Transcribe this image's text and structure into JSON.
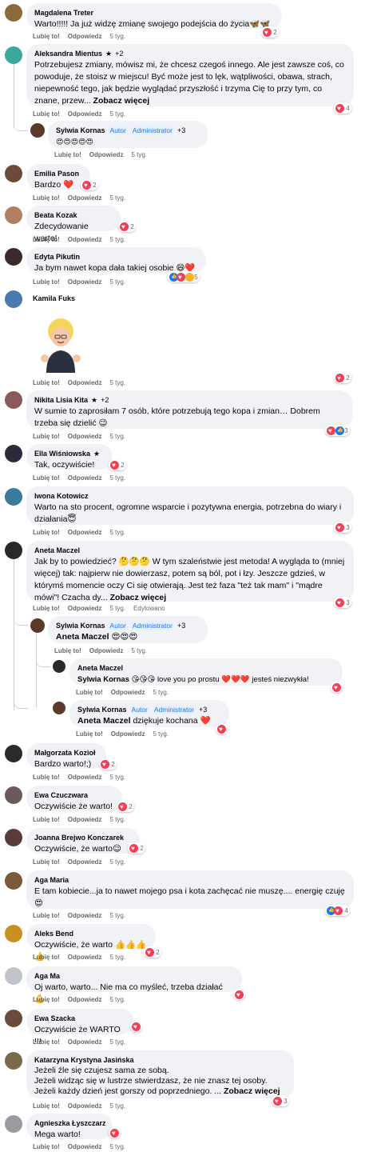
{
  "labels": {
    "like": "Lubię to!",
    "reply": "Odpowiedz",
    "edited": "Edytowano",
    "see_more": "Zobacz więcej",
    "author": "Autor",
    "admin": "Administrator"
  },
  "comments": [
    {
      "name": "Magdalena Treter",
      "text": "Warto!!!!! Ja już widzę zmianę swojego podejścia do życia🦋🦋",
      "time": "5 tyg.",
      "count": "2",
      "avatar": "#8a6a3a"
    },
    {
      "name": "Aleksandra Mientus",
      "badge": "+2",
      "text": "Potrzebujesz zmiany, mówisz mi, że chcesz czegoś innego. Ale jest zawsze coś, co powoduje, że stoisz w miejscu! Być może jest to lęk, wątpliwości, obawa, strach, niepewność tego, jak będzie wyglądać przyszłość i trzyma Cię to przy tym, co znane, przew...",
      "time": "5 tyg.",
      "count": "4",
      "avatar": "#3aa89a"
    },
    {
      "name": "Sylwia Kornas",
      "badge": "+3",
      "text": "😍😍😍😍😍",
      "time": "5 tyg.",
      "avatar": "#5b3a2a"
    },
    {
      "name": "Emilia Pason",
      "text": "Bardzo ❤️",
      "time": "5 tyg.",
      "count": "2",
      "avatar": "#6b4a3a"
    },
    {
      "name": "Beata Kozak",
      "text": "Zdecydowanie warto!",
      "time": "5 tyg.",
      "count": "2",
      "avatar": "#b08060"
    },
    {
      "name": "Edyta Pikutin",
      "text": "Ja bym nawet kopa dała takiej osobie 😄❤️",
      "time": "5 tyg.",
      "count": "5",
      "avatar": "#3a2a2a"
    },
    {
      "name": "Kamila Fuks",
      "time": "5 tyg.",
      "count": "2",
      "avatar": "#4a7ab0"
    },
    {
      "name": "Nikita Lisia Kita",
      "badge": "+2",
      "text": "W sumie to zaprosiłam 7 osób, które potrzebują tego kopa i zmian… Dobrem trzeba się dzielić 😉",
      "time": "5 tyg.",
      "count": "3",
      "avatar": "#8a5a5a"
    },
    {
      "name": "Ella Wiśniowska",
      "text": "Tak, oczywiście!",
      "time": "5 tyg.",
      "count": "2",
      "avatar": "#2a2a3a"
    },
    {
      "name": "Iwona Kotowicz",
      "text": "Warto na sto procent, ogromne wsparcie i pozytywna energia, potrzebna do wiary i działania😇",
      "time": "5 tyg.",
      "count": "3",
      "avatar": "#3a7a9a"
    },
    {
      "name": "Aneta Maczel",
      "text": "Jak by to powiedzieć? 🤔🤔🤔 W tym szaleństwie jest metoda! A wygląda to (mniej więcej) tak: najpierw nie dowierzasz, potem są ból, pot i łzy. Jeszcze gdzieś, w którymś momencie oczy Ci się otwierają. Jest też faza \"też tak mam\" i \"mądre mówi\"! Czacha dy...",
      "time": "5 tyg.",
      "count": "3",
      "avatar": "#2a2a2a"
    },
    {
      "name": "Sylwia Kornas",
      "badge": "+3",
      "mention": "Aneta Maczel",
      "text": "😍😍😍",
      "time": "5 tyg.",
      "avatar": "#5b3a2a"
    },
    {
      "name": "Aneta Maczel",
      "mention": "Sylwia Kornas",
      "text": "😘😘😘 love you po prostu ❤️❤️❤️ jesteś niezwykła!",
      "time": "5 tyg.",
      "avatar": "#2a2a2a"
    },
    {
      "name": "Sylwia Kornas",
      "badge": "+3",
      "mention": "Aneta Maczel",
      "text": "dziękuje kochana ❤️",
      "time": "5 tyg.",
      "avatar": "#5b3a2a"
    },
    {
      "name": "Małgorzata Kozioł",
      "text": "Bardzo warto!;)",
      "time": "5 tyg.",
      "count": "2",
      "avatar": "#2a2a2a"
    },
    {
      "name": "Ewa Czuczwara",
      "text": "Oczywiście że warto!",
      "time": "5 tyg.",
      "count": "2",
      "avatar": "#6a5a5a"
    },
    {
      "name": "Joanna Brejwo Konczarek",
      "text": "Oczywiście, że warto😉",
      "time": "5 tyg.",
      "count": "2",
      "avatar": "#5a3a3a"
    },
    {
      "name": "Aga Maria",
      "text": "E tam kobiecie...ja to nawet mojego psa i kota zachęcać nie muszę.... energię czuję 😍",
      "time": "5 tyg.",
      "count": "4",
      "avatar": "#7a5a3a"
    },
    {
      "name": "Aleks Bend",
      "text": "Oczywiście, że warto 👍👍👍👍",
      "time": "5 tyg.",
      "count": "2",
      "avatar": "#c89020"
    },
    {
      "name": "Aga Ma",
      "text": "Oj warto, warto... Nie ma co myśleć, trzeba działać 💪",
      "time": "5 tyg.",
      "avatar": "#c0c4ca"
    },
    {
      "name": "Ewa Szacka",
      "text": "Oczywiście że WARTO !!!",
      "time": "5 tyg.",
      "avatar": "#6a4a3a"
    },
    {
      "name": "Katarzyna Krystyna Jasińska",
      "text1": "Jeżeli źle się czujesz sama ze sobą.",
      "text2": "Jeżeli widząc się w lustrze stwierdzasz, że nie znasz tej osoby.",
      "text3": "Jeżeli każdy dzień jest gorszy od poprzedniego. ...",
      "time": "5 tyg.",
      "count": "3",
      "avatar": "#7a6a4a"
    },
    {
      "name": "Agnieszka Łyszczarz",
      "text": "Mega warto!",
      "time": "5 tyg.",
      "avatar": "#9a9aa0"
    }
  ]
}
